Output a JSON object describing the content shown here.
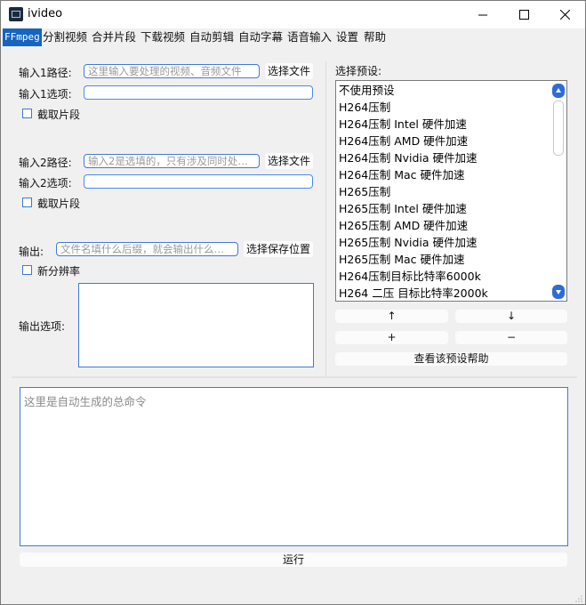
{
  "window": {
    "title": "ivideo"
  },
  "tabs": [
    "FFmpeg",
    "分割视频",
    "合并片段",
    "下载视频",
    "自动剪辑",
    "自动字幕",
    "语音输入",
    "设置",
    "帮助"
  ],
  "input1": {
    "path_label": "输入1路径:",
    "path_placeholder": "这里输入要处理的视频、音频文件",
    "choose_file": "选择文件",
    "options_label": "输入1选项:",
    "clip_label": "截取片段"
  },
  "input2": {
    "path_label": "输入2路径:",
    "path_placeholder": "输入2是选填的，只有涉及同时处…",
    "choose_file": "选择文件",
    "options_label": "输入2选项:",
    "clip_label": "截取片段"
  },
  "output": {
    "label": "输出:",
    "placeholder": "文件名填什么后缀，就会输出什么…",
    "choose_save": "选择保存位置",
    "new_resolution": "新分辨率",
    "options_label": "输出选项:"
  },
  "presets": {
    "label": "选择预设:",
    "items": [
      "不使用预设",
      "H264压制",
      "H264压制 Intel 硬件加速",
      "H264压制 AMD 硬件加速",
      "H264压制 Nvidia 硬件加速",
      "H264压制 Mac 硬件加速",
      "H265压制",
      "H265压制 Intel 硬件加速",
      "H265压制 AMD 硬件加速",
      "H265压制 Nvidia 硬件加速",
      "H265压制 Mac 硬件加速",
      "H264压制目标比特率6000k",
      "H264 二压 目标比特率2000k"
    ],
    "up_arrow": "↑",
    "down_arrow": "↓",
    "add": "+",
    "remove": "−",
    "help": "查看该预设帮助"
  },
  "command": {
    "placeholder": "这里是自动生成的总命令"
  },
  "run_button": "运行",
  "colors": {
    "accent": "#1565c0",
    "input_border": "#3f7ad8"
  }
}
